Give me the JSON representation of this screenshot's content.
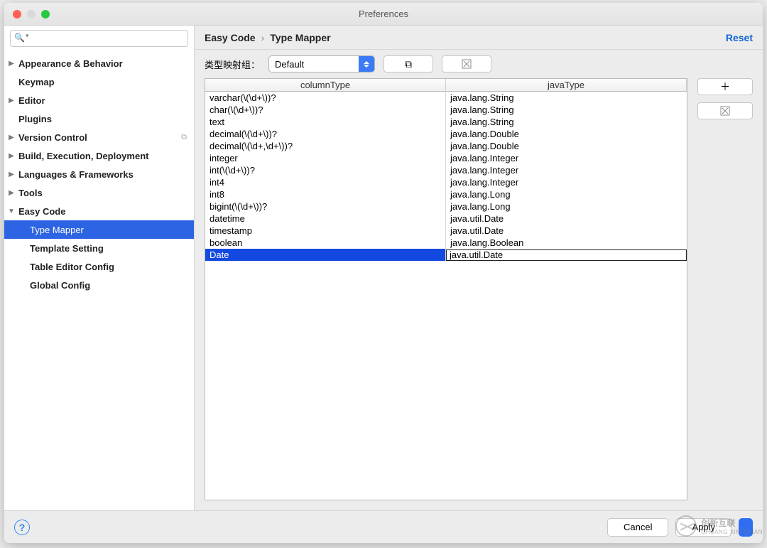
{
  "title": "Preferences",
  "search_placeholder": "",
  "sidebar": {
    "items": [
      {
        "label": "Appearance & Behavior",
        "expand": true,
        "bold": true
      },
      {
        "label": "Keymap",
        "expand": false,
        "bold": true
      },
      {
        "label": "Editor",
        "expand": true,
        "bold": true
      },
      {
        "label": "Plugins",
        "expand": false,
        "bold": true
      },
      {
        "label": "Version Control",
        "expand": true,
        "bold": true,
        "badge": "⧉"
      },
      {
        "label": "Build, Execution, Deployment",
        "expand": true,
        "bold": true
      },
      {
        "label": "Languages & Frameworks",
        "expand": true,
        "bold": true
      },
      {
        "label": "Tools",
        "expand": true,
        "bold": true
      },
      {
        "label": "Easy Code",
        "expand": true,
        "bold": true,
        "open": true
      }
    ],
    "easycode_children": [
      {
        "label": "Type Mapper",
        "selected": true
      },
      {
        "label": "Template Setting"
      },
      {
        "label": "Table Editor Config"
      },
      {
        "label": "Global Config"
      }
    ]
  },
  "crumbs": {
    "root": "Easy Code",
    "leaf": "Type Mapper",
    "reset": "Reset"
  },
  "toolbar": {
    "group_label": "类型映射组：",
    "select_value": "Default"
  },
  "columns": {
    "c1": "columnType",
    "c2": "javaType"
  },
  "rows": [
    {
      "c1": "varchar(\\(\\d+\\))?",
      "c2": "java.lang.String"
    },
    {
      "c1": "char(\\(\\d+\\))?",
      "c2": "java.lang.String"
    },
    {
      "c1": "text",
      "c2": "java.lang.String"
    },
    {
      "c1": "decimal(\\(\\d+\\))?",
      "c2": "java.lang.Double"
    },
    {
      "c1": "decimal(\\(\\d+,\\d+\\))?",
      "c2": "java.lang.Double"
    },
    {
      "c1": "integer",
      "c2": "java.lang.Integer"
    },
    {
      "c1": "int(\\(\\d+\\))?",
      "c2": "java.lang.Integer"
    },
    {
      "c1": "int4",
      "c2": "java.lang.Integer"
    },
    {
      "c1": "int8",
      "c2": "java.lang.Long"
    },
    {
      "c1": "bigint(\\(\\d+\\))?",
      "c2": "java.lang.Long"
    },
    {
      "c1": "datetime",
      "c2": "java.util.Date"
    },
    {
      "c1": "timestamp",
      "c2": "java.util.Date"
    },
    {
      "c1": "boolean",
      "c2": "java.lang.Boolean"
    },
    {
      "c1": "Date",
      "c2": "java.util.Date",
      "selected": true,
      "editing": true
    }
  ],
  "footer": {
    "cancel": "Cancel",
    "apply": "Apply"
  },
  "watermark": {
    "brand": "创新互联",
    "sub": "CHUANG XINTULIAN"
  }
}
